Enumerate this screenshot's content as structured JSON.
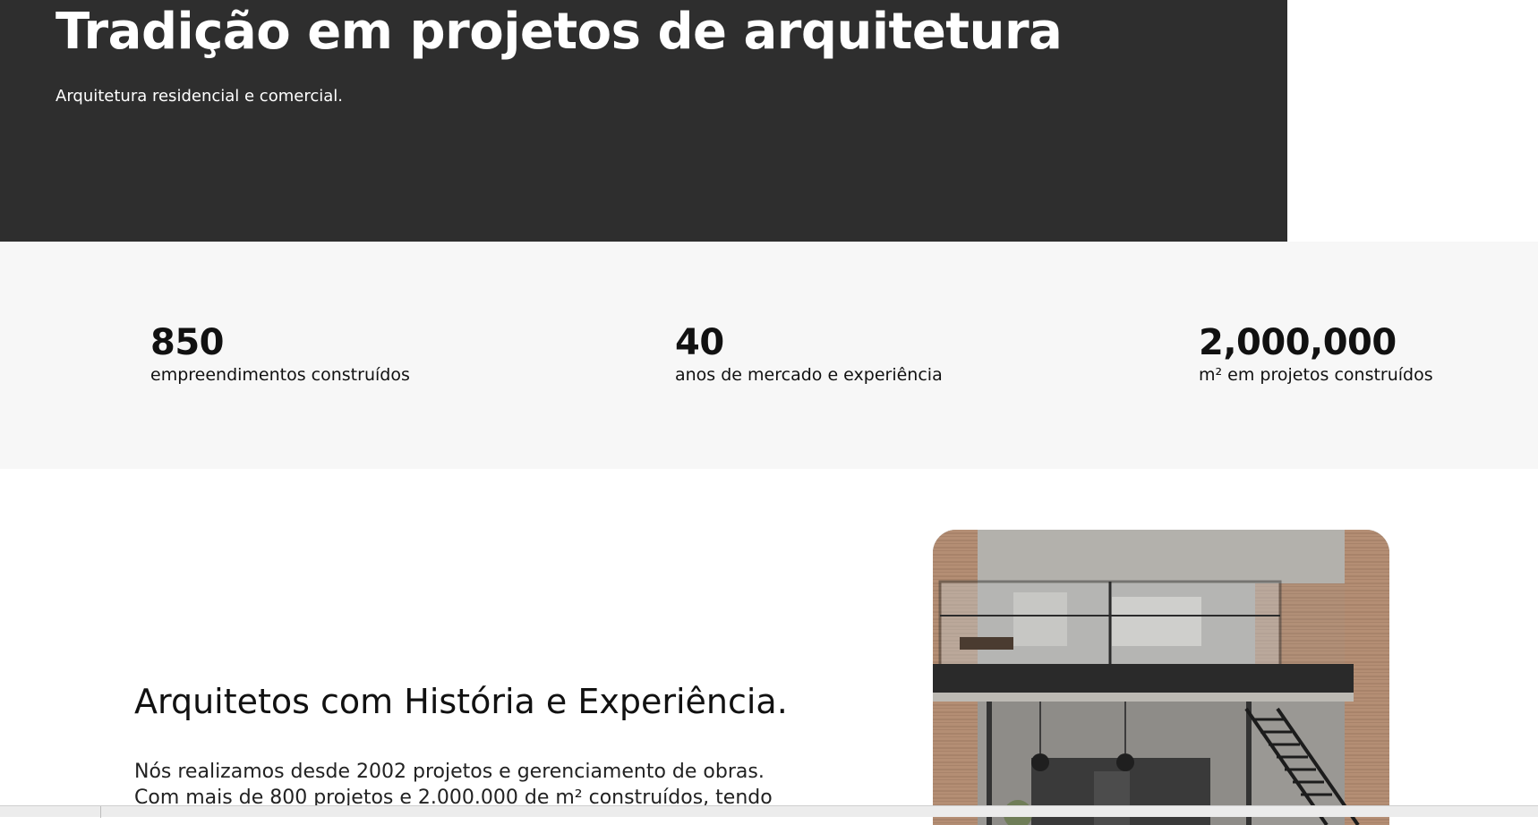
{
  "hero": {
    "title": "Tradição em projetos de arquitetura",
    "subtitle": "Arquitetura residencial e comercial."
  },
  "stats": [
    {
      "value": "850",
      "label": "empreendimentos construídos"
    },
    {
      "value": "40",
      "label": "anos de mercado e experiência"
    },
    {
      "value": "2,000,000",
      "label": "m² em projetos construídos"
    }
  ],
  "about": {
    "title": "Arquitetos com História e Experiência.",
    "body_line1": "Nós realizamos desde 2002 projetos e gerenciamento de obras.",
    "body_line2": "Com mais de 800 projetos e 2.000.000 de m² construídos, tendo"
  },
  "colors": {
    "hero_bg": "#2e2e2e",
    "stats_bg": "#f7f7f7"
  }
}
